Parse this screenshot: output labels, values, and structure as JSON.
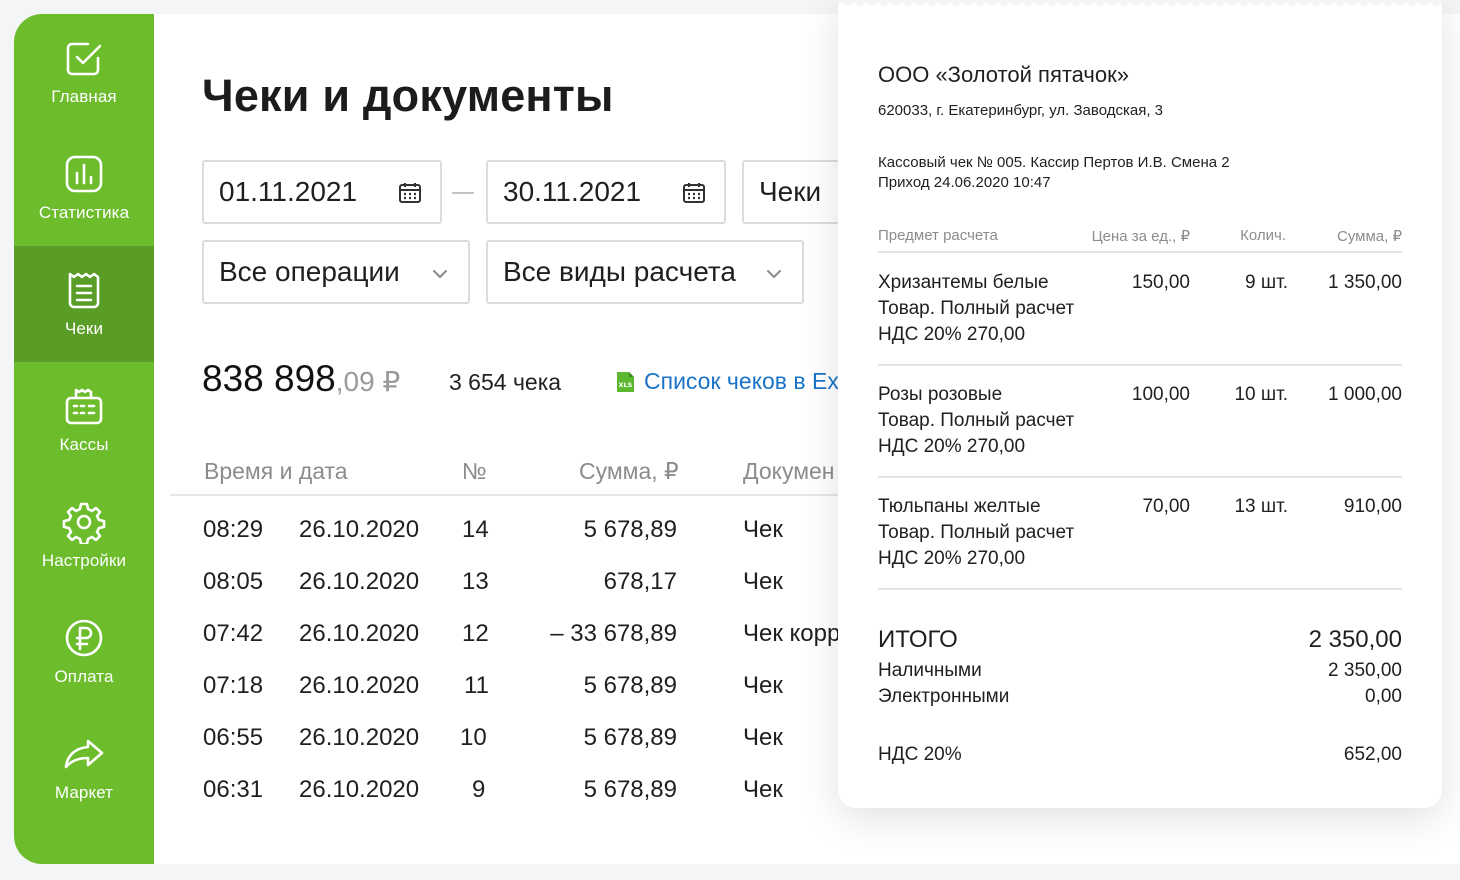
{
  "sidebar": {
    "items": [
      {
        "label": "Главная",
        "icon": "check-square-icon"
      },
      {
        "label": "Статистика",
        "icon": "bar-chart-icon"
      },
      {
        "label": "Чеки",
        "icon": "receipt-icon"
      },
      {
        "label": "Кассы",
        "icon": "cash-register-icon"
      },
      {
        "label": "Настройки",
        "icon": "gear-icon"
      },
      {
        "label": "Оплата",
        "icon": "ruble-icon"
      },
      {
        "label": "Маркет",
        "icon": "share-arrow-icon"
      }
    ],
    "active_index": 2,
    "color": "#6cbc2c",
    "active_color": "#5a9d26"
  },
  "page": {
    "title": "Чеки и документы"
  },
  "filters": {
    "date_from": "01.11.2021",
    "date_to": "30.11.2021",
    "doc_type": "Чеки",
    "operations": "Все операции",
    "payment_types": "Все виды расчета"
  },
  "summary": {
    "total_main": "838 898",
    "total_cents": ",09 ₽",
    "count": "3 654 чека",
    "export_label": "Список чеков в Ex"
  },
  "table": {
    "headers": {
      "time_date": "Время и дата",
      "number": "№",
      "sum": "Сумма, ₽",
      "doc": "Докумен"
    },
    "rows": [
      {
        "time": "08:29",
        "date": "26.10.2020",
        "num": "14",
        "sum": "5 678,89",
        "doc": "Чек"
      },
      {
        "time": "08:05",
        "date": "26.10.2020",
        "num": "13",
        "sum": "678,17",
        "doc": "Чек"
      },
      {
        "time": "07:42",
        "date": "26.10.2020",
        "num": "12",
        "sum": "– 33 678,89",
        "doc": "Чек корр"
      },
      {
        "time": "07:18",
        "date": "26.10.2020",
        "num": "11",
        "sum": "5 678,89",
        "doc": "Чек"
      },
      {
        "time": "06:55",
        "date": "26.10.2020",
        "num": "10",
        "sum": "5 678,89",
        "doc": "Чек"
      },
      {
        "time": "06:31",
        "date": "26.10.2020",
        "num": "9",
        "sum": "5 678,89",
        "doc": "Чек"
      }
    ]
  },
  "receipt": {
    "company": "ООО «Золотой пятачок»",
    "address": "620033, г. Екатеринбург, ул. Заводская, 3",
    "check_info": "Кассовый чек № 005. Кассир Пертов И.В. Смена 2",
    "check_date": "Приход 24.06.2020 10:47",
    "headers": {
      "item": "Предмет расчета",
      "price": "Цена за ед., ₽",
      "qty": "Колич.",
      "sum": "Сумма, ₽"
    },
    "items": [
      {
        "name": "Хризантемы белые",
        "type": "Товар. Полный расчет",
        "vat": "НДС 20% 270,00",
        "price": "150,00",
        "qty": "9 шт.",
        "sum": "1 350,00"
      },
      {
        "name": "Розы розовые",
        "type": "Товар. Полный расчет",
        "vat": "НДС 20% 270,00",
        "price": "100,00",
        "qty": "10 шт.",
        "sum": "1 000,00"
      },
      {
        "name": "Тюльпаны желтые",
        "type": "Товар. Полный расчет",
        "vat": "НДС 20% 270,00",
        "price": "70,00",
        "qty": "13 шт.",
        "sum": "910,00"
      }
    ],
    "total_label": "ИТОГО",
    "total_value": "2 350,00",
    "cash_label": "Наличными",
    "cash_value": "2 350,00",
    "electronic_label": "Электронными",
    "electronic_value": "0,00",
    "vat_label": "НДС 20%",
    "vat_value": "652,00"
  }
}
